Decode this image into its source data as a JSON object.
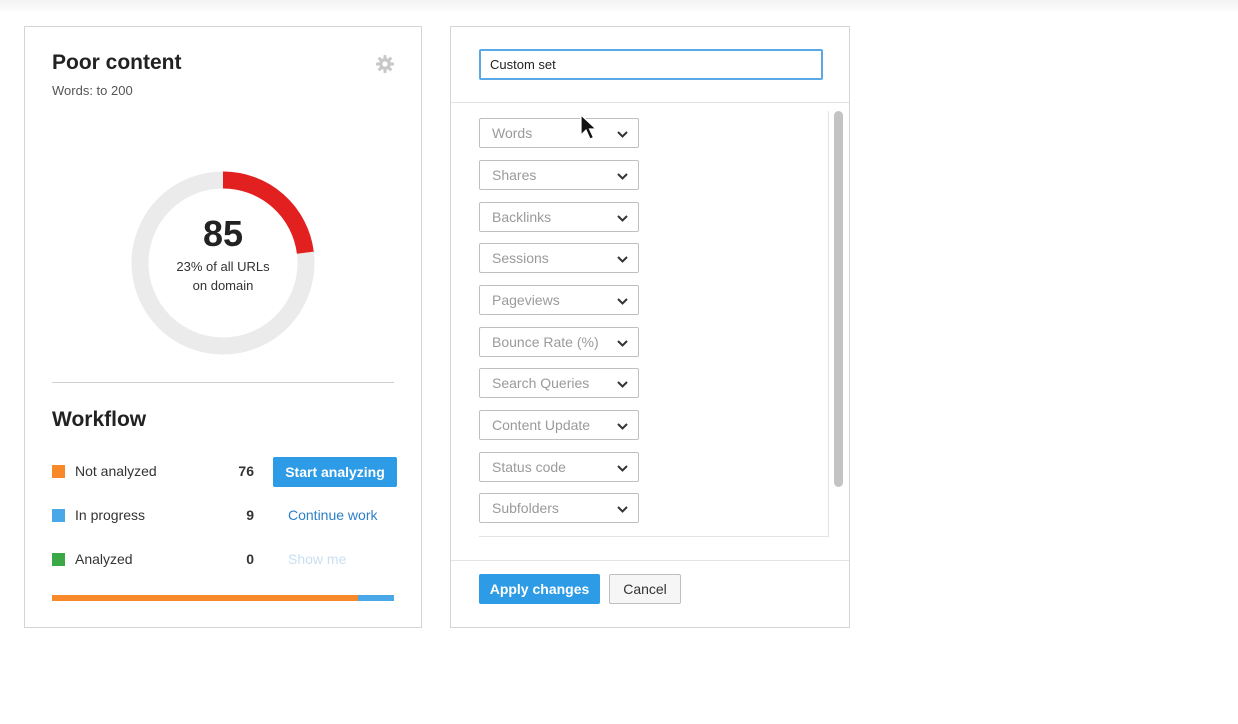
{
  "summary_card": {
    "title": "Poor content",
    "subtitle": "Words: to 200",
    "settings_icon": "gear-icon",
    "donut": {
      "value": "85",
      "caption_line1": "23% of all URLs",
      "caption_line2": "on domain",
      "percent": 0.23,
      "fill_color": "#e32020",
      "track_color": "#ebebeb"
    }
  },
  "workflow": {
    "title": "Workflow",
    "rows": [
      {
        "label": "Not analyzed",
        "count": "76",
        "action": "Start analyzing",
        "color": "#f7892a"
      },
      {
        "label": "In progress",
        "count": "9",
        "action": "Continue work",
        "color": "#4aa8e9"
      },
      {
        "label": "Analyzed",
        "count": "0",
        "action": "Show me",
        "color": "#3aa845"
      }
    ],
    "progress": [
      {
        "fraction": 0.8941,
        "color": "#f7892a"
      },
      {
        "fraction": 0.1059,
        "color": "#4aa8e9"
      },
      {
        "fraction": 0,
        "color": "#3aa845"
      }
    ]
  },
  "filter_panel": {
    "name_value": "Custom set",
    "filters": [
      "Words",
      "Shares",
      "Backlinks",
      "Sessions",
      "Pageviews",
      "Bounce Rate (%)",
      "Search Queries",
      "Content Update",
      "Status code",
      "Subfolders"
    ],
    "apply_label": "Apply changes",
    "cancel_label": "Cancel"
  },
  "colors": {
    "accent": "#2d9be5",
    "link": "#2d7fc7"
  }
}
